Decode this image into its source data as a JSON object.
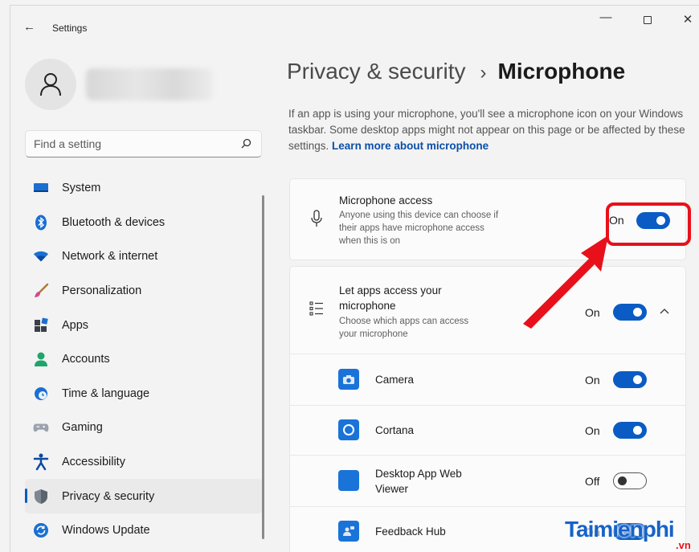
{
  "window": {
    "title": "Settings",
    "back_glyph": "←",
    "minimize_glyph": "—",
    "close_glyph": "✕"
  },
  "user": {
    "avatar_icon": "person-icon"
  },
  "search": {
    "placeholder": "Find a setting"
  },
  "sidebar": {
    "items": [
      {
        "label": "System",
        "icon": "monitor-icon"
      },
      {
        "label": "Bluetooth & devices",
        "icon": "bluetooth-icon"
      },
      {
        "label": "Network & internet",
        "icon": "wifi-icon"
      },
      {
        "label": "Personalization",
        "icon": "brush-icon"
      },
      {
        "label": "Apps",
        "icon": "apps-icon"
      },
      {
        "label": "Accounts",
        "icon": "person-icon"
      },
      {
        "label": "Time & language",
        "icon": "globe-clock-icon"
      },
      {
        "label": "Gaming",
        "icon": "gamepad-icon"
      },
      {
        "label": "Accessibility",
        "icon": "accessibility-icon"
      },
      {
        "label": "Privacy & security",
        "icon": "shield-icon",
        "active": true
      },
      {
        "label": "Windows Update",
        "icon": "update-icon"
      }
    ]
  },
  "header": {
    "parent": "Privacy & security",
    "separator": "›",
    "current": "Microphone"
  },
  "description": {
    "text": "If an app is using your microphone, you'll see a microphone icon on your Windows taskbar. Some desktop apps might not appear on this page or be affected by these settings.",
    "link": "Learn more about microphone"
  },
  "microphone_access": {
    "title": "Microphone access",
    "subtitle_lines": [
      "Anyone using this device can choose if",
      "their apps have microphone access",
      "when this is on"
    ],
    "state": "On",
    "enabled": true
  },
  "let_apps_access": {
    "title_lines": [
      "Let apps access your",
      "microphone"
    ],
    "subtitle_lines": [
      "Choose which apps can access",
      "your microphone"
    ],
    "state": "On",
    "enabled": true,
    "expand_icon": "chevron-up-icon"
  },
  "apps": [
    {
      "name": "Camera",
      "state": "On",
      "enabled": true,
      "icon": "camera-icon"
    },
    {
      "name": "Cortana",
      "state": "On",
      "enabled": true,
      "icon": "cortana-icon"
    },
    {
      "name_lines": [
        "Desktop App Web",
        "Viewer"
      ],
      "state": "Off",
      "enabled": false,
      "icon": "web-viewer-icon"
    },
    {
      "name": "Feedback Hub",
      "state": "On",
      "enabled": true,
      "icon": "feedback-icon"
    }
  ],
  "colors": {
    "accent": "#0a5cc4",
    "highlight": "#e8101a",
    "background": "#f3f3f3",
    "card": "#fbfbfb"
  },
  "watermark": {
    "text": "Taimienphi",
    "suffix": ".vn"
  }
}
